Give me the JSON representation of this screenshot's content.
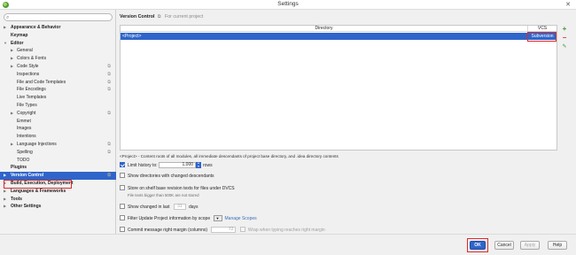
{
  "window": {
    "title": "Settings",
    "close_glyph": "✕"
  },
  "sidebar": {
    "search": {
      "placeholder": "",
      "value": ""
    },
    "items": [
      {
        "label": "Appearance & Behavior",
        "bold": true,
        "arrow": "▶",
        "indent": 0
      },
      {
        "label": "Keymap",
        "bold": true,
        "arrow": "",
        "indent": 0
      },
      {
        "label": "Editor",
        "bold": true,
        "arrow": "▼",
        "indent": 0
      },
      {
        "label": "General",
        "arrow": "▶",
        "indent": 1
      },
      {
        "label": "Colors & Fonts",
        "arrow": "▶",
        "indent": 1
      },
      {
        "label": "Code Style",
        "arrow": "▶",
        "indent": 1,
        "gear": true
      },
      {
        "label": "Inspections",
        "arrow": "",
        "indent": 1,
        "gear": true
      },
      {
        "label": "File and Code Templates",
        "arrow": "",
        "indent": 1,
        "gear": true
      },
      {
        "label": "File Encodings",
        "arrow": "",
        "indent": 1,
        "gear": true
      },
      {
        "label": "Live Templates",
        "arrow": "",
        "indent": 1
      },
      {
        "label": "File Types",
        "arrow": "",
        "indent": 1
      },
      {
        "label": "Copyright",
        "arrow": "▶",
        "indent": 1,
        "gear": true
      },
      {
        "label": "Emmet",
        "arrow": "",
        "indent": 1
      },
      {
        "label": "Images",
        "arrow": "",
        "indent": 1
      },
      {
        "label": "Intentions",
        "arrow": "",
        "indent": 1
      },
      {
        "label": "Language Injections",
        "arrow": "▶",
        "indent": 1,
        "gear": true
      },
      {
        "label": "Spelling",
        "arrow": "",
        "indent": 1,
        "gear": true
      },
      {
        "label": "TODO",
        "arrow": "",
        "indent": 1
      },
      {
        "label": "Plugins",
        "bold": true,
        "arrow": "",
        "indent": 0
      },
      {
        "label": "Version Control",
        "bold": true,
        "arrow": "▶",
        "indent": 0,
        "selected": true,
        "gear": true
      },
      {
        "label": "Build, Execution, Deployment",
        "bold": true,
        "arrow": "▶",
        "indent": 0
      },
      {
        "label": "Languages & Frameworks",
        "bold": true,
        "arrow": "▶",
        "indent": 0
      },
      {
        "label": "Tools",
        "bold": true,
        "arrow": "▶",
        "indent": 0
      },
      {
        "label": "Other Settings",
        "bold": true,
        "arrow": "▶",
        "indent": 0
      }
    ]
  },
  "main": {
    "breadcrumb_title": "Version Control",
    "breadcrumb_icon": "⧉",
    "breadcrumb_sub": "For current project",
    "table": {
      "columns": [
        "Directory",
        "VCS"
      ],
      "rows": [
        {
          "directory": "<Project>",
          "vcs": "Subversion"
        }
      ]
    },
    "tools": {
      "add": "+",
      "remove": "−",
      "edit": "✎"
    },
    "legend": "<Project> - Content roots of all modules, all immediate descendants of project base directory, and .idea directory contents",
    "options": {
      "limit_history": {
        "label": "Limit history to:",
        "value": "1,000",
        "suffix": "rows",
        "checked": true
      },
      "show_dirs": {
        "label": "Show directories with changed descendants",
        "checked": false
      },
      "store_shelf": {
        "label": "Store on shelf base revision texts for files under DVCS",
        "checked": false,
        "hint": "File texts bigger than 500K are not stored"
      },
      "show_changed": {
        "label": "Show changed in last",
        "value": "31",
        "suffix": "days",
        "checked": false
      },
      "filter_update": {
        "label": "Filter Update Project information by scope",
        "link": "Manage Scopes",
        "checked": false
      },
      "commit_margin": {
        "label": "Commit message right margin (columns)",
        "value": "72",
        "wrap_label": "Wrap when typing reaches right margin",
        "checked": false
      }
    }
  },
  "footer": {
    "ok": "OK",
    "cancel": "Cancel",
    "apply": "Apply",
    "help": "Help"
  },
  "colors": {
    "selection": "#2f65ca",
    "highlight_outline": "#e02828",
    "add_icon": "#3c9b2c",
    "remove_icon": "#d33a2c"
  }
}
